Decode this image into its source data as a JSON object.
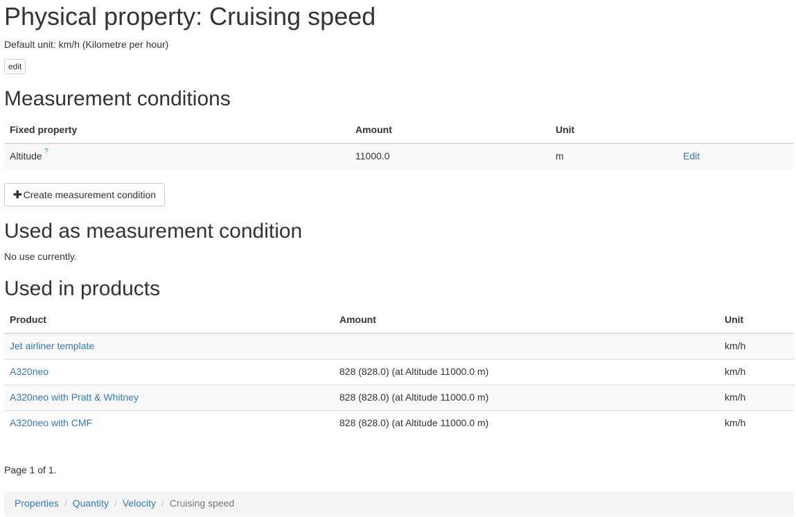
{
  "page_title": "Physical property: Cruising speed",
  "default_unit_text": "Default unit: km/h (Kilometre per hour)",
  "edit_button": "edit",
  "measurement_conditions": {
    "heading": "Measurement conditions",
    "headers": {
      "fixed_property": "Fixed property",
      "amount": "Amount",
      "unit": "Unit"
    },
    "rows": [
      {
        "property": "Altitude",
        "help": "?",
        "amount": "11000.0",
        "unit": "m",
        "edit": "Edit"
      }
    ],
    "create_button": "Create measurement condition"
  },
  "used_as_condition": {
    "heading": "Used as measurement condition",
    "text": "No use currently."
  },
  "used_in_products": {
    "heading": "Used in products",
    "headers": {
      "product": "Product",
      "amount": "Amount",
      "unit": "Unit"
    },
    "rows": [
      {
        "product": "Jet airliner template",
        "amount": "",
        "unit": "km/h"
      },
      {
        "product": "A320neo",
        "amount": "828 (828.0) (at Altitude 11000.0 m)",
        "unit": "km/h"
      },
      {
        "product": "A320neo with Pratt & Whitney",
        "amount": "828 (828.0) (at Altitude 11000.0 m)",
        "unit": "km/h"
      },
      {
        "product": "A320neo with CMF",
        "amount": "828 (828.0) (at Altitude 11000.0 m)",
        "unit": "km/h"
      }
    ]
  },
  "pagination_text": "Page 1 of 1.",
  "breadcrumb": {
    "items": [
      "Properties",
      "Quantity",
      "Velocity"
    ],
    "active": "Cruising speed"
  },
  "colors": {
    "link": "#337ab7",
    "stripe": "#f9f9f9",
    "breadcrumb_bg": "#f5f5f5"
  }
}
